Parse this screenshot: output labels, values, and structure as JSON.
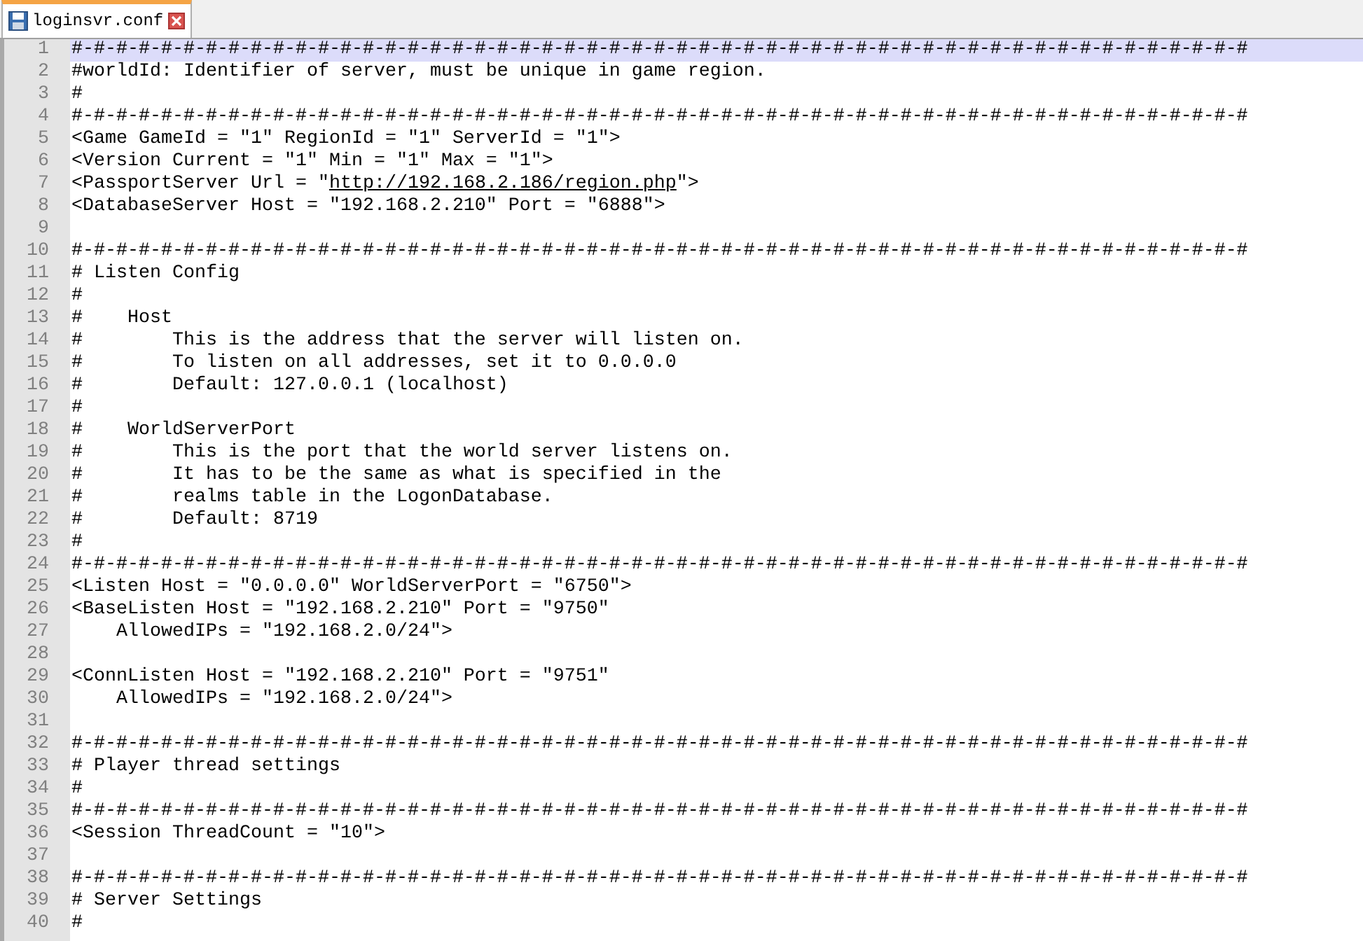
{
  "tabs": [
    {
      "label": "loginsvr.conf",
      "selected": true
    }
  ],
  "lines": [
    {
      "number": "1",
      "text": "#-#-#-#-#-#-#-#-#-#-#-#-#-#-#-#-#-#-#-#-#-#-#-#-#-#-#-#-#-#-#-#-#-#-#-#-#-#-#-#-#-#-#-#-#-#-#-#-#-#-#-#-#",
      "selected": true
    },
    {
      "number": "2",
      "text": "#worldId: Identifier of server, must be unique in game region.",
      "selected": false
    },
    {
      "number": "3",
      "text": "#",
      "selected": false
    },
    {
      "number": "4",
      "text": "#-#-#-#-#-#-#-#-#-#-#-#-#-#-#-#-#-#-#-#-#-#-#-#-#-#-#-#-#-#-#-#-#-#-#-#-#-#-#-#-#-#-#-#-#-#-#-#-#-#-#-#-#",
      "selected": false
    },
    {
      "number": "5",
      "text": "<Game GameId = \"1\" RegionId = \"1\" ServerId = \"1\">",
      "selected": false
    },
    {
      "number": "6",
      "text": "<Version Current = \"1\" Min = \"1\" Max = \"1\">",
      "selected": false
    },
    {
      "number": "7",
      "text": "<PassportServer Url = \"",
      "link": "http://192.168.2.186/region.php",
      "after": "\">",
      "selected": false
    },
    {
      "number": "8",
      "text": "<DatabaseServer Host = \"192.168.2.210\" Port = \"6888\">",
      "selected": false
    },
    {
      "number": "9",
      "selected": false
    },
    {
      "number": "10",
      "text": "#-#-#-#-#-#-#-#-#-#-#-#-#-#-#-#-#-#-#-#-#-#-#-#-#-#-#-#-#-#-#-#-#-#-#-#-#-#-#-#-#-#-#-#-#-#-#-#-#-#-#-#-#",
      "selected": false
    },
    {
      "number": "11",
      "text": "# Listen Config",
      "selected": false
    },
    {
      "number": "12",
      "text": "#",
      "selected": false
    },
    {
      "number": "13",
      "text": "#    Host",
      "selected": false
    },
    {
      "number": "14",
      "text": "#        This is the address that the server will listen on.",
      "selected": false
    },
    {
      "number": "15",
      "text": "#        To listen on all addresses, set it to 0.0.0.0",
      "selected": false
    },
    {
      "number": "16",
      "text": "#        Default: 127.0.0.1 (localhost)",
      "selected": false
    },
    {
      "number": "17",
      "text": "#",
      "selected": false
    },
    {
      "number": "18",
      "text": "#    WorldServerPort",
      "selected": false
    },
    {
      "number": "19",
      "text": "#        This is the port that the world server listens on.",
      "selected": false
    },
    {
      "number": "20",
      "text": "#        It has to be the same as what is specified in the",
      "selected": false
    },
    {
      "number": "21",
      "text": "#        realms table in the LogonDatabase.",
      "selected": false
    },
    {
      "number": "22",
      "text": "#        Default: 8719",
      "selected": false
    },
    {
      "number": "23",
      "text": "#",
      "selected": false
    },
    {
      "number": "24",
      "text": "#-#-#-#-#-#-#-#-#-#-#-#-#-#-#-#-#-#-#-#-#-#-#-#-#-#-#-#-#-#-#-#-#-#-#-#-#-#-#-#-#-#-#-#-#-#-#-#-#-#-#-#-#",
      "selected": false
    },
    {
      "number": "25",
      "text": "<Listen Host = \"0.0.0.0\" WorldServerPort = \"6750\">",
      "selected": false
    },
    {
      "number": "26",
      "text": "<BaseListen Host = \"192.168.2.210\" Port = \"9750\"",
      "selected": false
    },
    {
      "number": "27",
      "text": "    AllowedIPs = \"192.168.2.0/24\">",
      "selected": false
    },
    {
      "number": "28",
      "selected": false
    },
    {
      "number": "29",
      "text": "<ConnListen Host = \"192.168.2.210\" Port = \"9751\"",
      "selected": false
    },
    {
      "number": "30",
      "text": "    AllowedIPs = \"192.168.2.0/24\">",
      "selected": false
    },
    {
      "number": "31",
      "selected": false
    },
    {
      "number": "32",
      "text": "#-#-#-#-#-#-#-#-#-#-#-#-#-#-#-#-#-#-#-#-#-#-#-#-#-#-#-#-#-#-#-#-#-#-#-#-#-#-#-#-#-#-#-#-#-#-#-#-#-#-#-#-#",
      "selected": false
    },
    {
      "number": "33",
      "text": "# Player thread settings",
      "selected": false
    },
    {
      "number": "34",
      "text": "#",
      "selected": false
    },
    {
      "number": "35",
      "text": "#-#-#-#-#-#-#-#-#-#-#-#-#-#-#-#-#-#-#-#-#-#-#-#-#-#-#-#-#-#-#-#-#-#-#-#-#-#-#-#-#-#-#-#-#-#-#-#-#-#-#-#-#",
      "selected": false
    },
    {
      "number": "36",
      "text": "<Session ThreadCount = \"10\">",
      "selected": false
    },
    {
      "number": "37",
      "selected": false
    },
    {
      "number": "38",
      "text": "#-#-#-#-#-#-#-#-#-#-#-#-#-#-#-#-#-#-#-#-#-#-#-#-#-#-#-#-#-#-#-#-#-#-#-#-#-#-#-#-#-#-#-#-#-#-#-#-#-#-#-#-#",
      "selected": false
    },
    {
      "number": "39",
      "text": "# Server Settings",
      "selected": false
    },
    {
      "number": "40",
      "text": "#",
      "selected": false
    }
  ]
}
